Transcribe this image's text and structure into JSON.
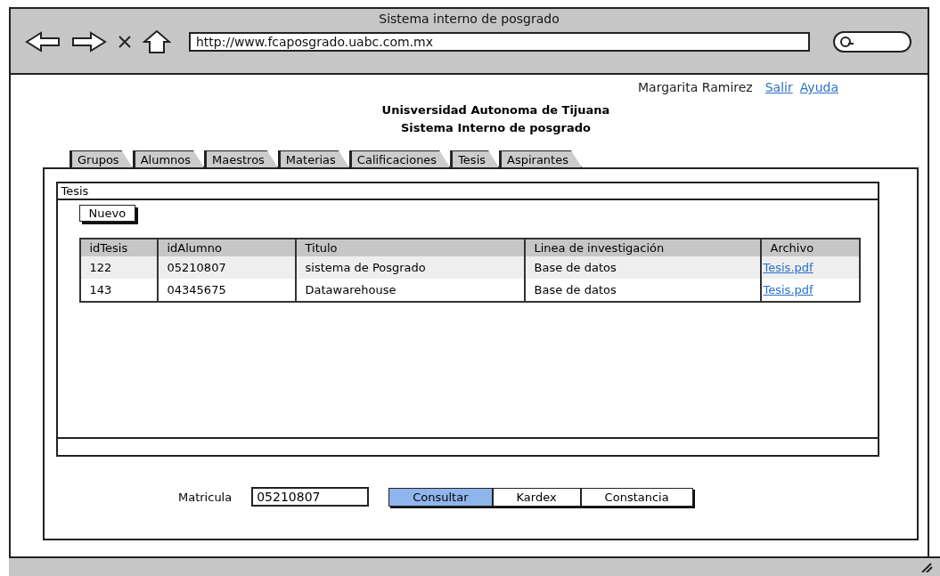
{
  "window": {
    "title": "Sistema interno de posgrado",
    "url": "http://www.fcaposgrado.uabc.com.mx"
  },
  "user": {
    "name": "Margarita Ramirez",
    "links": [
      "Salir",
      "Ayuda"
    ]
  },
  "header": [
    "Unisversidad Autonoma de Tijuana",
    "Sistema Interno de posgrado"
  ],
  "tabs": [
    {
      "label": "Grupos"
    },
    {
      "label": "Alumnos"
    },
    {
      "label": "Maestros"
    },
    {
      "label": "Materias"
    },
    {
      "label": "Calificaciones"
    },
    {
      "label": "Tesis"
    },
    {
      "label": "Aspirantes"
    }
  ],
  "panel": {
    "title": "Tesis",
    "new_button": "Nuevo"
  },
  "table": {
    "columns": [
      "idTesis",
      "idAlumno",
      "Titulo",
      "Linea de investigación",
      "Archivo"
    ],
    "rows": [
      [
        "122",
        "05210807",
        "sistema de Posgrado",
        "Base de datos",
        "Tesis.pdf"
      ],
      [
        "143",
        "04345675",
        "Datawarehouse",
        "Base de datos",
        "Tesis.pdf"
      ]
    ]
  },
  "search": {
    "label": "Matricula",
    "value": "05210807"
  },
  "buttons": [
    {
      "label": "Consultar",
      "selected": true
    },
    {
      "label": "Kardex",
      "selected": false
    },
    {
      "label": "Constancia",
      "selected": false
    }
  ]
}
